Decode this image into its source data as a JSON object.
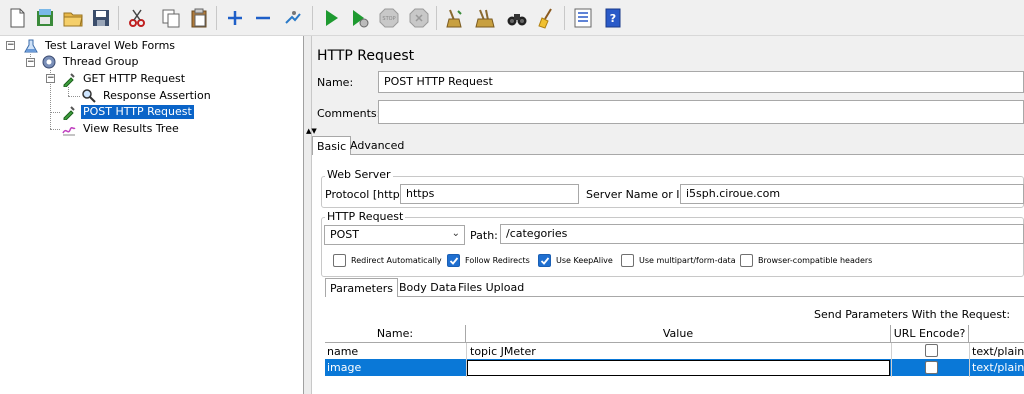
{
  "toolbar": {
    "buttons": [
      {
        "icon": "new-file-icon"
      },
      {
        "icon": "templates-icon"
      },
      {
        "icon": "open-folder-icon"
      },
      {
        "icon": "save-icon"
      },
      {
        "icon": "cut-icon"
      },
      {
        "icon": "copy-icon"
      },
      {
        "icon": "paste-icon"
      },
      {
        "icon": "expand-plus-icon"
      },
      {
        "icon": "collapse-minus-icon"
      },
      {
        "icon": "toggle-icon"
      },
      {
        "icon": "start-icon"
      },
      {
        "icon": "start-no-pause-icon"
      },
      {
        "icon": "stop-icon"
      },
      {
        "icon": "shutdown-icon"
      },
      {
        "icon": "clear-icon"
      },
      {
        "icon": "clear-all-icon"
      },
      {
        "icon": "search-binoculars-icon"
      },
      {
        "icon": "reset-search-broom-icon"
      },
      {
        "icon": "function-helper-icon"
      },
      {
        "icon": "help-icon"
      }
    ]
  },
  "tree": {
    "root": "Test Laravel Web Forms",
    "thread_group": "Thread Group",
    "get_request": "GET HTTP Request",
    "response_assertion": "Response Assertion",
    "post_request": "POST HTTP Request",
    "view_results": "View Results Tree"
  },
  "panel": {
    "title": "HTTP Request",
    "name_label": "Name:",
    "name_value": "POST HTTP Request",
    "comments_label": "Comments:",
    "comments_value": "",
    "tabs": [
      "Basic",
      "Advanced"
    ],
    "web_server": {
      "title": "Web Server",
      "protocol_label": "Protocol [http]:",
      "protocol_value": "https",
      "server_label": "Server Name or IP:",
      "server_value": "i5sph.ciroue.com"
    },
    "http_request": {
      "title": "HTTP Request",
      "method": "POST",
      "path_label": "Path:",
      "path_value": "/categories"
    },
    "checkboxes": [
      {
        "label": "Redirect Automatically",
        "checked": false
      },
      {
        "label": "Follow Redirects",
        "checked": true
      },
      {
        "label": "Use KeepAlive",
        "checked": true
      },
      {
        "label": "Use multipart/form-data",
        "checked": false
      },
      {
        "label": "Browser-compatible headers",
        "checked": false
      }
    ],
    "subtabs": [
      "Parameters",
      "Body Data",
      "Files Upload"
    ],
    "send_params_label": "Send Parameters With the Request:",
    "table": {
      "headers": [
        "Name:",
        "Value",
        "URL Encode?",
        ""
      ],
      "rows": [
        {
          "name": "name",
          "value": "topic JMeter",
          "url_encode": false,
          "content_type": "text/plain"
        },
        {
          "name": "image",
          "value": "",
          "url_encode": false,
          "content_type": "text/plain"
        }
      ]
    }
  },
  "colors": {
    "selection": "#0a64c8",
    "row_selection": "#0a78d7",
    "checkbox_on": "#1f6fd0"
  }
}
